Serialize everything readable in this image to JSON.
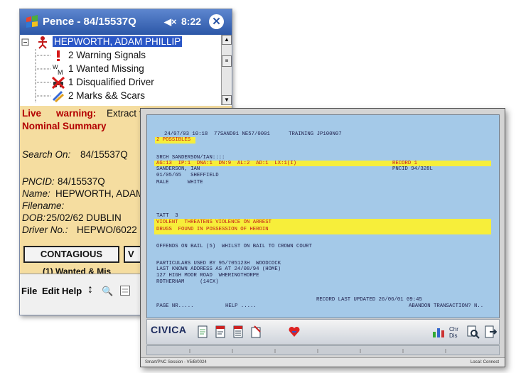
{
  "pda": {
    "title": "Pence - 84/15537Q",
    "speaker_icon_glyph": "◀×",
    "time": "8:22",
    "close_glyph": "✕",
    "tree": {
      "root_label": "HEPWORTH, ADAM PHILLIP",
      "items": [
        {
          "label": "2 Warning Signals",
          "icon": "exclamation-icon"
        },
        {
          "label": "1 Wanted Missing",
          "icon": "wanted-missing-icon"
        },
        {
          "label": "1 Disqualified Driver",
          "icon": "disqualified-driver-icon"
        },
        {
          "label": "2 Marks && Scars",
          "icon": "marks-scars-icon"
        }
      ]
    },
    "summary": {
      "live_label": "Live",
      "warning_text": "warning:",
      "extract_text": "Extract from PNC",
      "heading": "Nominal Summary",
      "search_label": "Search On:",
      "search_value": "84/15537Q",
      "pncid_label": "PNCID:",
      "pncid_value": "84/15537Q",
      "name_label": "Name:",
      "name_value": "HEPWORTH, ADAM",
      "filename_label": "Filename:",
      "dob_label": "DOB:",
      "dob_value": "25/02/62 DUBLIN",
      "driver_label": "Driver No.:",
      "driver_value": "HEPWO/6022",
      "btn_contagious": "CONTAGIOUS",
      "btn_v": "V",
      "partial_row": "(1) Wanted & Mis"
    },
    "menu": {
      "file": "File",
      "edit": "Edit",
      "help": "Help",
      "sort_glyph": "↕",
      "search_glyph": "🔍"
    }
  },
  "terminal": {
    "lines": {
      "header": "24/07/03 10:18  77SAND01 NE57/0001      TRAINING JP100N07",
      "possibles": "2 POSSIBLES",
      "srch": "SRCH SANDERSON/IAN::::",
      "codes": "AG:13  IP:1  DNA:1  DN:9  AL:2  AD:1  LX:1(I)",
      "record": "RECORD 1",
      "name": "SANDERSON, IAN",
      "pncid": "PNCID 94/328L",
      "dob": "01/05/65   SHEFFIELD",
      "sex": "MALE      WHITE",
      "tatt": "TATT  3",
      "violent": "VIOLENT  THREATENS VIOLENCE ON ARREST",
      "drugs": "DRUGS  FOUND IN POSSESSION OF HEROIN",
      "offends": "OFFENDS ON BAIL (5)  WHILST ON BAIL TO CROWN COURT",
      "particulars": "PARTICULARS USED BY 95/705123H  WOODCOCK",
      "last_addr": "LAST KNOWN ADDRESS AS AT 24/08/94 (HOME)",
      "street": "127 HIGH MOOR ROAD  WHERINGTHORPE",
      "town": "ROTHERHAM     (14CX)",
      "updated": "RECORD LAST UPDATED 26/06/01 09:45",
      "page": "PAGE NR.....",
      "help": "HELP .....",
      "abandon": "ABANDON TRANSACTION? N.."
    },
    "toolbar": {
      "brand": "CIVICA"
    },
    "status": {
      "left": "Smart/PNC Session - V5/B/0024",
      "right": "Local: Connect"
    },
    "colors": {
      "screen_bg": "#a4c9e8",
      "highlight": "#f7ee3a",
      "warning_red": "#c21a1a"
    }
  }
}
